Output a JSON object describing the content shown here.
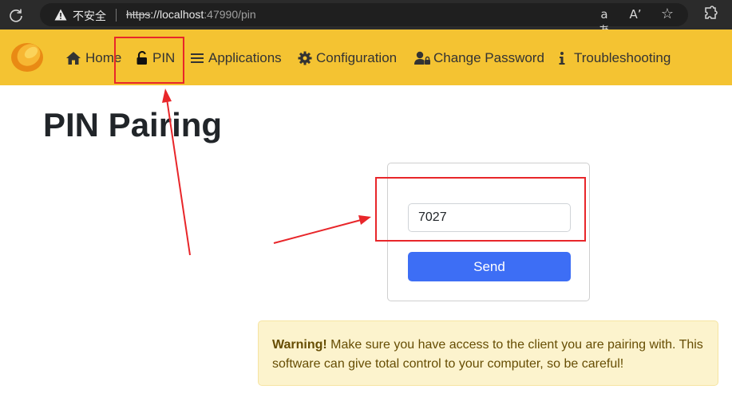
{
  "browser": {
    "security_label": "不安全",
    "url_protocol": "https",
    "url_host": "://localhost",
    "url_rest": ":47990/pin",
    "icons": [
      "reload-icon",
      "warning-icon",
      "translate-icon",
      "read-aloud-icon",
      "favorite-star-icon",
      "extensions-icon"
    ],
    "translate_glyph": "aあ",
    "read_aloud_glyph": "Aʼ",
    "star_glyph": "☆"
  },
  "nav": {
    "items": [
      {
        "label": "Home",
        "icon": "home-icon"
      },
      {
        "label": "PIN",
        "icon": "unlock-icon"
      },
      {
        "label": "Applications",
        "icon": "list-icon"
      },
      {
        "label": "Configuration",
        "icon": "gear-icon"
      },
      {
        "label": "Change Password",
        "icon": "user-lock-icon"
      },
      {
        "label": "Troubleshooting",
        "icon": "info-icon"
      }
    ]
  },
  "main": {
    "title": "PIN Pairing",
    "pin_value": "7027",
    "send_label": "Send",
    "warning_bold": "Warning!",
    "warning_text": " Make sure you have access to the client you are pairing with. This software can give total control to your computer, so be careful!"
  },
  "colors": {
    "nav_bg": "#f4c332",
    "button_bg": "#3d6ef5",
    "annotation": "#e8262a",
    "alert_bg": "#fcf3cd"
  }
}
